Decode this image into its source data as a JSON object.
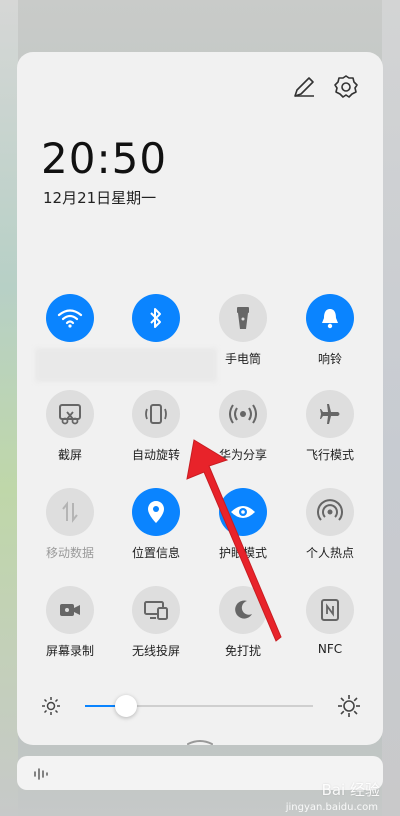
{
  "status": {
    "time": "20:50",
    "date": "12月21日星期一"
  },
  "top_icons": [
    {
      "icon": "pencil-edit-icon"
    },
    {
      "icon": "gear-icon"
    }
  ],
  "tiles": [
    {
      "label": "",
      "icon": "wifi-icon",
      "state": "on"
    },
    {
      "label": "",
      "icon": "bluetooth-icon",
      "state": "on"
    },
    {
      "label": "手电筒",
      "icon": "flashlight-icon",
      "state": "off"
    },
    {
      "label": "响铃",
      "icon": "bell-icon",
      "state": "on"
    },
    {
      "label": "截屏",
      "icon": "screenshot-icon",
      "state": "off"
    },
    {
      "label": "自动旋转",
      "icon": "rotate-icon",
      "state": "off"
    },
    {
      "label": "华为分享",
      "icon": "share-wireless-icon",
      "state": "off"
    },
    {
      "label": "飞行模式",
      "icon": "airplane-icon",
      "state": "off"
    },
    {
      "label": "移动数据",
      "icon": "mobile-data-icon",
      "state": "disabled"
    },
    {
      "label": "位置信息",
      "icon": "location-icon",
      "state": "on"
    },
    {
      "label": "护眼模式",
      "icon": "eye-icon",
      "state": "on"
    },
    {
      "label": "个人热点",
      "icon": "hotspot-icon",
      "state": "off"
    },
    {
      "label": "屏幕录制",
      "icon": "screen-record-icon",
      "state": "off"
    },
    {
      "label": "无线投屏",
      "icon": "cast-icon",
      "state": "off"
    },
    {
      "label": "免打扰",
      "icon": "moon-icon",
      "state": "off"
    },
    {
      "label": "NFC",
      "icon": "nfc-icon",
      "state": "off"
    }
  ],
  "brightness": {
    "level": 0.18
  },
  "watermark": {
    "text": "Bai 经验",
    "url": "jingyan.baidu.com"
  },
  "colors": {
    "accent": "#0a84ff",
    "arrow": "#e8232a"
  }
}
